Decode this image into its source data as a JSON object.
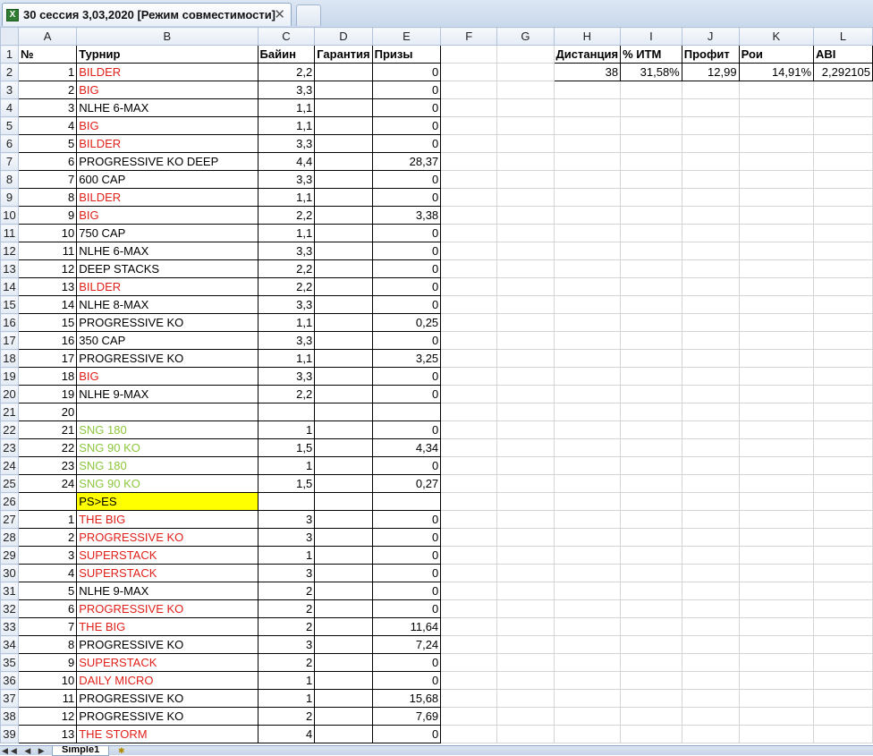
{
  "window": {
    "tab_title": "30 сессия 3,03,2020  [Режим совместимости]",
    "close_glyph": "✕",
    "icon": "excel-icon"
  },
  "columns": [
    "A",
    "B",
    "C",
    "D",
    "E",
    "F",
    "G",
    "H",
    "I",
    "J",
    "K",
    "L"
  ],
  "header_row": {
    "A": "№",
    "B": "Турнир",
    "C": "Байин",
    "D": "Гарантия",
    "E": "Призы",
    "H": "Дистанция",
    "I": "% ИТМ",
    "J": "Профит",
    "K": "Рои",
    "L": "ABI"
  },
  "summary_row": {
    "H": "38",
    "I": "31,58%",
    "J": "12,99",
    "K": "14,91%",
    "L": "2,292105"
  },
  "rows": [
    {
      "n": "1",
      "name": "BILDER",
      "color": "red",
      "buyin": "2,2",
      "prize": "0"
    },
    {
      "n": "2",
      "name": "BIG",
      "color": "red",
      "buyin": "3,3",
      "prize": "0"
    },
    {
      "n": "3",
      "name": "NLHE 6-MAX",
      "color": "black",
      "buyin": "1,1",
      "prize": "0"
    },
    {
      "n": "4",
      "name": "BIG",
      "color": "red",
      "buyin": "1,1",
      "prize": "0"
    },
    {
      "n": "5",
      "name": "BILDER",
      "color": "red",
      "buyin": "3,3",
      "prize": "0"
    },
    {
      "n": "6",
      "name": "PROGRESSIVE KO DEEP",
      "color": "black",
      "buyin": "4,4",
      "prize": "28,37"
    },
    {
      "n": "7",
      "name": "600 CAP",
      "color": "black",
      "buyin": "3,3",
      "prize": "0"
    },
    {
      "n": "8",
      "name": "BILDER",
      "color": "red",
      "buyin": "1,1",
      "prize": "0"
    },
    {
      "n": "9",
      "name": "BIG",
      "color": "red",
      "buyin": "2,2",
      "prize": "3,38"
    },
    {
      "n": "10",
      "name": "750 CAP",
      "color": "black",
      "buyin": "1,1",
      "prize": "0"
    },
    {
      "n": "11",
      "name": "NLHE 6-MAX",
      "color": "black",
      "buyin": "3,3",
      "prize": "0"
    },
    {
      "n": "12",
      "name": "DEEP STACKS",
      "color": "black",
      "buyin": "2,2",
      "prize": "0"
    },
    {
      "n": "13",
      "name": "BILDER",
      "color": "red",
      "buyin": "2,2",
      "prize": "0"
    },
    {
      "n": "14",
      "name": "NLHE 8-MAX",
      "color": "black",
      "buyin": "3,3",
      "prize": "0"
    },
    {
      "n": "15",
      "name": "PROGRESSIVE KO",
      "color": "black",
      "buyin": "1,1",
      "prize": "0,25"
    },
    {
      "n": "16",
      "name": "350 CAP",
      "color": "black",
      "buyin": "3,3",
      "prize": "0"
    },
    {
      "n": "17",
      "name": "PROGRESSIVE KO",
      "color": "black",
      "buyin": "1,1",
      "prize": "3,25"
    },
    {
      "n": "18",
      "name": "BIG",
      "color": "red",
      "buyin": "3,3",
      "prize": "0"
    },
    {
      "n": "19",
      "name": "NLHE 9-MAX",
      "color": "black",
      "buyin": "2,2",
      "prize": "0"
    },
    {
      "n": "20",
      "name": "",
      "color": "black",
      "buyin": "",
      "prize": ""
    },
    {
      "n": "21",
      "name": "SNG 180",
      "color": "green",
      "buyin": "1",
      "prize": "0"
    },
    {
      "n": "22",
      "name": "SNG 90 KO",
      "color": "green",
      "buyin": "1,5",
      "prize": "4,34"
    },
    {
      "n": "23",
      "name": "SNG 180",
      "color": "green",
      "buyin": "1",
      "prize": "0"
    },
    {
      "n": "24",
      "name": "SNG 90 KO",
      "color": "green",
      "buyin": "1,5",
      "prize": "0,27"
    },
    {
      "n": "",
      "name": "PS>ES",
      "color": "black",
      "buyin": "",
      "prize": "",
      "highlight": true
    },
    {
      "n": "1",
      "name": "THE BIG",
      "color": "red",
      "buyin": "3",
      "prize": "0"
    },
    {
      "n": "2",
      "name": "PROGRESSIVE KO",
      "color": "red",
      "buyin": "3",
      "prize": "0"
    },
    {
      "n": "3",
      "name": "SUPERSTACK",
      "color": "red",
      "buyin": "1",
      "prize": "0"
    },
    {
      "n": "4",
      "name": "SUPERSTACK",
      "color": "red",
      "buyin": "3",
      "prize": "0"
    },
    {
      "n": "5",
      "name": "NLHE 9-MAX",
      "color": "black",
      "buyin": "2",
      "prize": "0"
    },
    {
      "n": "6",
      "name": "PROGRESSIVE KO",
      "color": "red",
      "buyin": "2",
      "prize": "0"
    },
    {
      "n": "7",
      "name": "THE BIG",
      "color": "red",
      "buyin": "2",
      "prize": "11,64"
    },
    {
      "n": "8",
      "name": "PROGRESSIVE KO",
      "color": "black",
      "buyin": "3",
      "prize": "7,24"
    },
    {
      "n": "9",
      "name": "SUPERSTACK",
      "color": "red",
      "buyin": "2",
      "prize": "0"
    },
    {
      "n": "10",
      "name": "DAILY MICRO",
      "color": "red",
      "buyin": "1",
      "prize": "0"
    },
    {
      "n": "11",
      "name": "PROGRESSIVE KO",
      "color": "black",
      "buyin": "1",
      "prize": "15,68"
    },
    {
      "n": "12",
      "name": "PROGRESSIVE KO",
      "color": "black",
      "buyin": "2",
      "prize": "7,69"
    },
    {
      "n": "13",
      "name": "THE STORM",
      "color": "red",
      "buyin": "4",
      "prize": "0"
    }
  ],
  "sheet_tabs": {
    "nav": "◀◀ ◀ ▶ ▶▶",
    "active": "Simple1"
  }
}
